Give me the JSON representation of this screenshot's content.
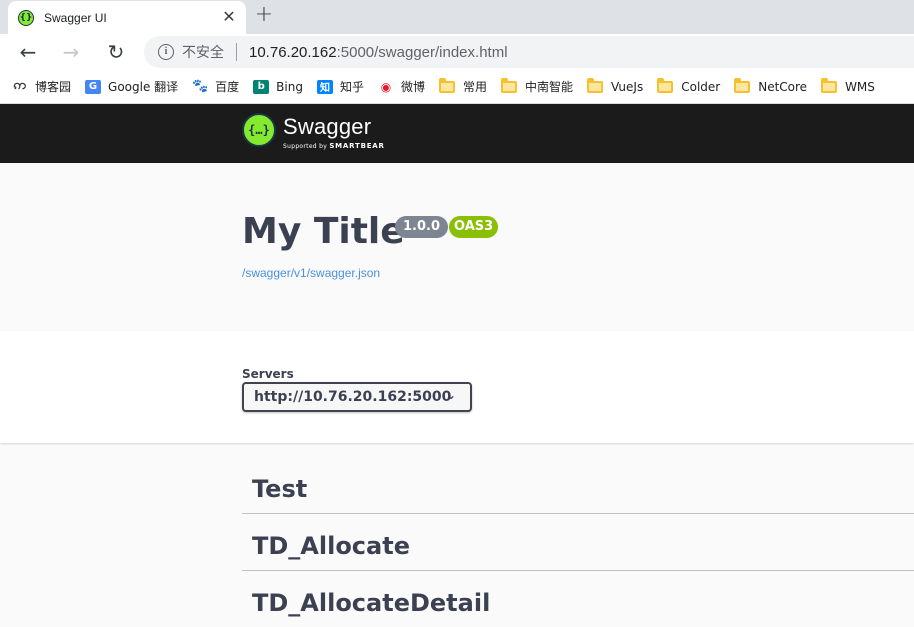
{
  "browser": {
    "tab": {
      "title": "Swagger UI"
    },
    "address": {
      "security_label": "不安全",
      "url_host": "10.76.20.162",
      "url_path": ":5000/swagger/index.html"
    },
    "bookmarks": [
      {
        "label": "博客园",
        "kind": "site"
      },
      {
        "label": "Google 翻译",
        "kind": "site"
      },
      {
        "label": "百度",
        "kind": "site"
      },
      {
        "label": "Bing",
        "kind": "site"
      },
      {
        "label": "知乎",
        "kind": "site"
      },
      {
        "label": "微博",
        "kind": "site"
      },
      {
        "label": "常用",
        "kind": "folder"
      },
      {
        "label": "中南智能",
        "kind": "folder"
      },
      {
        "label": "VueJs",
        "kind": "folder"
      },
      {
        "label": "Colder",
        "kind": "folder"
      },
      {
        "label": "NetCore",
        "kind": "folder"
      },
      {
        "label": "WMS",
        "kind": "folder"
      }
    ]
  },
  "swagger": {
    "logo": {
      "name": "Swagger",
      "supported_by": "Supported by",
      "brand": "SMARTBEAR"
    },
    "info": {
      "title": "My Title",
      "version": "1.0.0",
      "oas": "OAS3",
      "spec_url": "/swagger/v1/swagger.json"
    },
    "servers": {
      "label": "Servers",
      "selected": "http://10.76.20.162:5000"
    },
    "tags": [
      "Test",
      "TD_Allocate",
      "TD_AllocateDetail"
    ]
  },
  "colors": {
    "topbar": "#1b1b1b",
    "swagger_green": "#85ea2d",
    "version_badge": "#7d8492",
    "oas_badge": "#89bf04",
    "link": "#4990e2"
  }
}
